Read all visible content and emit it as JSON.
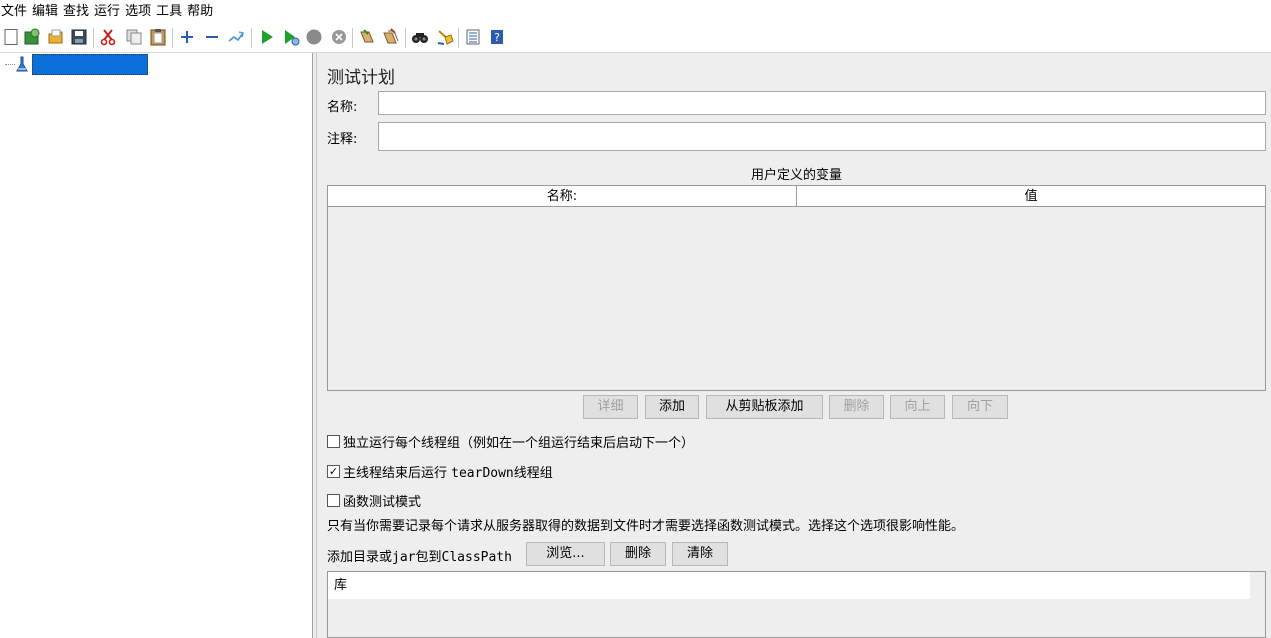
{
  "menu": [
    "文件",
    "编辑",
    "查找",
    "运行",
    "选项",
    "工具",
    "帮助"
  ],
  "toolbar_icons": [
    "new-icon",
    "templates-icon",
    "open-icon",
    "save-icon",
    "cut-icon",
    "copy-icon",
    "paste-icon",
    "expand-icon",
    "collapse-icon",
    "toggle-icon",
    "start-icon",
    "start-no-timers-icon",
    "stop-icon",
    "shutdown-icon",
    "clear-icon",
    "clear-all-icon",
    "search-icon",
    "reset-search-icon",
    "function-helper-icon",
    "help-icon"
  ],
  "plan": {
    "title": "测试计划",
    "name_label": "名称:",
    "name_value": "",
    "comment_label": "注释:",
    "comment_value": ""
  },
  "variables": {
    "section_title": "用户定义的变量",
    "columns": [
      "名称:",
      "值"
    ],
    "rows": []
  },
  "var_buttons": [
    {
      "label": "详细",
      "enabled": false
    },
    {
      "label": "添加",
      "enabled": true
    },
    {
      "label": "从剪贴板添加",
      "enabled": true
    },
    {
      "label": "删除",
      "enabled": false
    },
    {
      "label": "向上",
      "enabled": false
    },
    {
      "label": "向下",
      "enabled": false
    }
  ],
  "options": {
    "independent": {
      "label": "独立运行每个线程组（例如在一个组运行结束后启动下一个）",
      "checked": false
    },
    "teardown": {
      "label_prefix": "主线程结束后运行 ",
      "label_code": "tearDown",
      "label_suffix": "线程组",
      "checked": true
    },
    "functional": {
      "label": "函数测试模式",
      "checked": false
    },
    "functional_note": "只有当你需要记录每个请求从服务器取得的数据到文件时才需要选择函数测试模式。选择这个选项很影响性能。"
  },
  "classpath": {
    "label_prefix": "添加目录或",
    "label_code": "jar",
    "label_mid": "包到",
    "label_code2": "ClassPath",
    "browse": "浏览...",
    "delete": "删除",
    "clear": "清除",
    "list_header": "库"
  },
  "colors": {
    "selection": "#0a6fd8",
    "panel_bg": "#eeeeee"
  }
}
